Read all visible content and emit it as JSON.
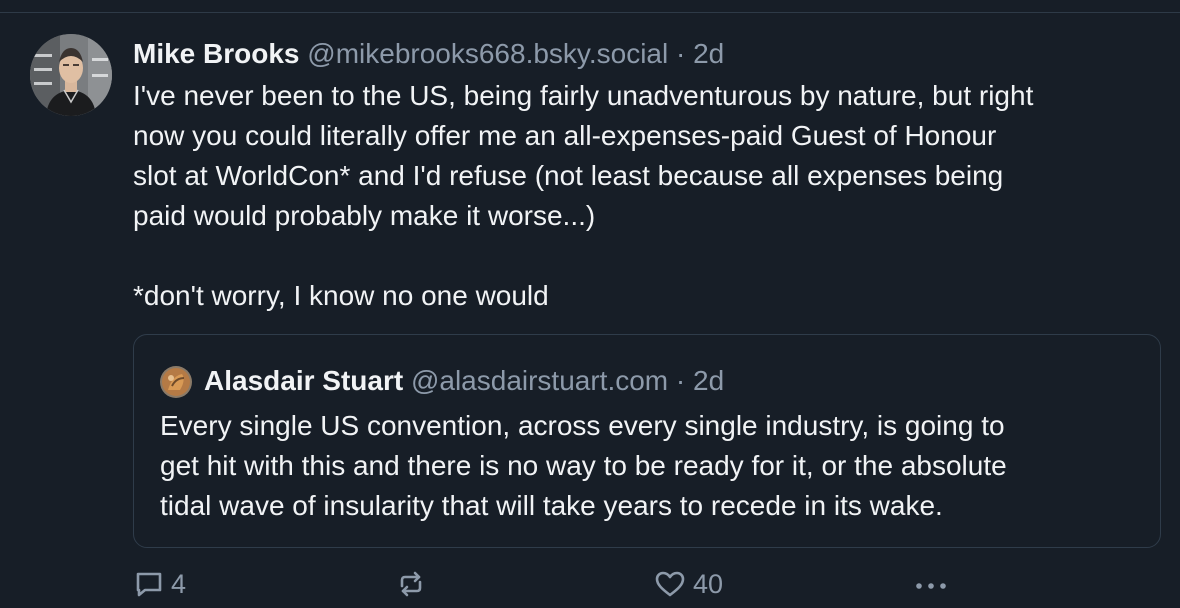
{
  "post": {
    "author_name": "Mike Brooks",
    "handle": "@mikebrooks668.bsky.social",
    "separator": "·",
    "time": "2d",
    "text_lines": [
      "I've never been to the US, being fairly unadventurous by nature, but right",
      "now you could literally offer me an all-expenses-paid Guest of Honour",
      "slot at WorldCon* and I'd refuse (not least because all expenses being",
      "paid would probably make it worse...)"
    ],
    "footnote": "*don't worry, I know no one would"
  },
  "quote": {
    "author_name": "Alasdair Stuart",
    "handle": "@alasdairstuart.com",
    "separator": "·",
    "time": "2d",
    "text_lines": [
      "Every single US convention, across every single industry, is going to",
      "get hit with this and there is no way to be ready for it, or the absolute",
      "tidal wave of insularity that will take years to recede in its wake."
    ]
  },
  "actions": {
    "reply_count": "4",
    "repost_count": "",
    "like_count": "40",
    "more_label": "•••"
  },
  "icons": {
    "reply": "reply-icon",
    "repost": "repost-icon",
    "like": "heart-icon",
    "more": "more-icon"
  },
  "colors": {
    "background": "#171e27",
    "text": "#f1f3f5",
    "muted": "#8d9aaa",
    "border": "#2f3c4a"
  }
}
